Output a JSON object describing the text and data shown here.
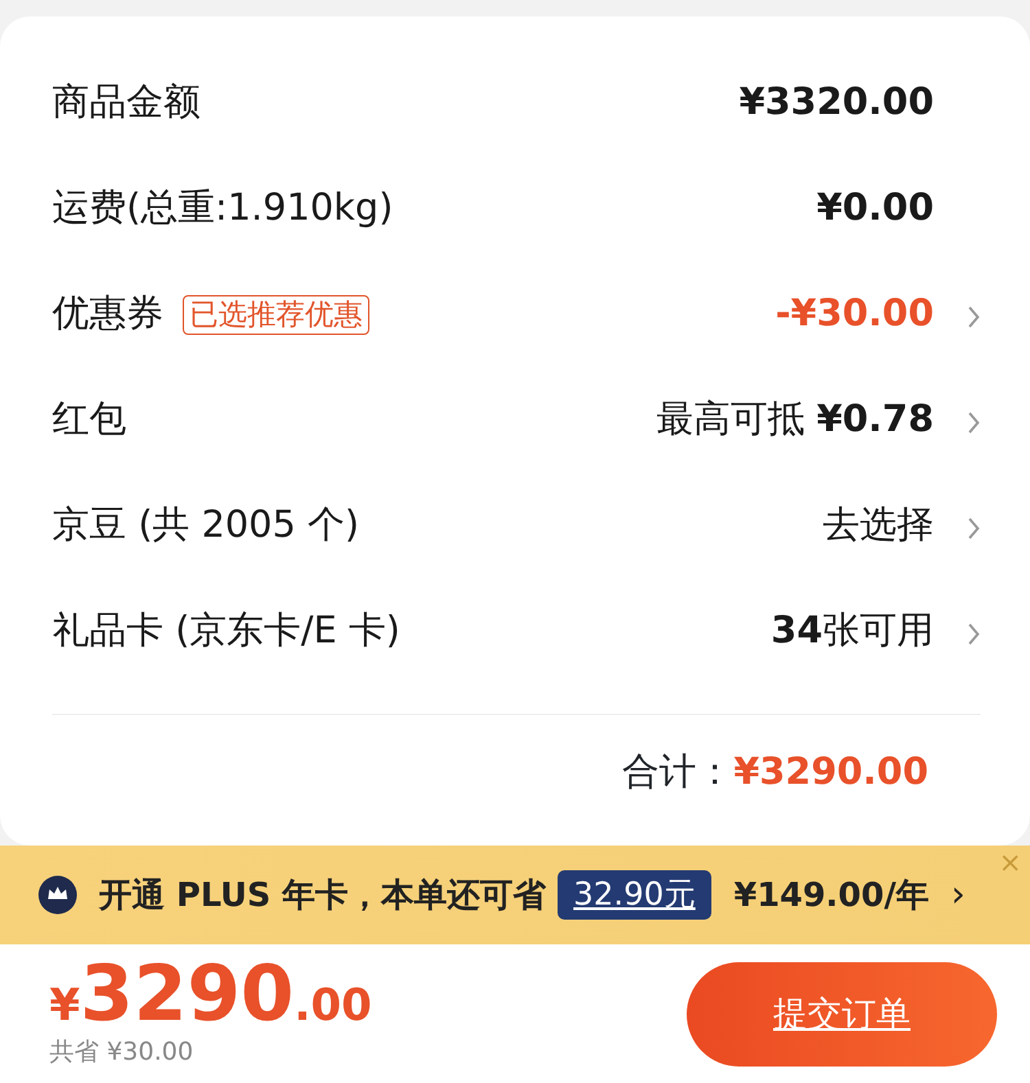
{
  "summary": {
    "rows": [
      {
        "label": "商品金额",
        "value": "¥3320.00",
        "kind": "amount",
        "chevron": false
      },
      {
        "label": "运费(总重:1.910kg)",
        "value": "¥0.00",
        "kind": "amount",
        "chevron": false
      },
      {
        "label": "优惠券",
        "tag": "已选推荐优惠",
        "value": "-¥30.00",
        "kind": "discount",
        "chevron": true
      },
      {
        "label": "红包",
        "value": "最高可抵 **¥0.78**",
        "kind": "plain",
        "chevron": true
      },
      {
        "label": "京豆 (共 2005 个)",
        "value": "去选择",
        "kind": "plain",
        "chevron": true
      },
      {
        "label": "礼品卡 (京东卡/E 卡)",
        "value": "**34**张可用",
        "kind": "plain",
        "chevron": true
      }
    ],
    "total_label": "合计：",
    "total_value": "¥3290.00"
  },
  "plus_banner": {
    "text": "开通 PLUS 年卡，本单还可省",
    "saving": "32.90元",
    "price": "¥149.00/年",
    "arrow": "›",
    "close": "×"
  },
  "bottom_bar": {
    "currency": "¥",
    "price_integer": "3290",
    "price_decimal": ".00",
    "saved": "共省 ¥30.00",
    "submit": "提交订单"
  }
}
